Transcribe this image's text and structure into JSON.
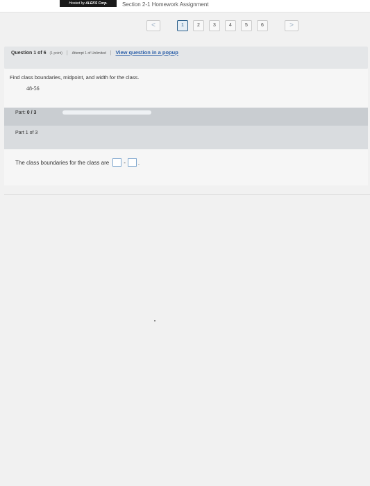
{
  "topbar": {
    "host_prefix": "Hosted by",
    "host_name": "ALEKS Corp.",
    "assignment_title": "Section 2-1 Homework Assignment"
  },
  "pager": {
    "prev_label": "<",
    "next_label": ">",
    "pages": [
      "1",
      "2",
      "3",
      "4",
      "5",
      "6"
    ],
    "active_page": "1"
  },
  "question": {
    "number_label": "Question 1 of 6",
    "points": "(1 point)",
    "attempt": "Attempt 1 of Unlimited",
    "popup_link": "View question in a popup"
  },
  "content": {
    "prompt": "Find class boundaries, midpoint, and width for the class.",
    "interval": "48-56"
  },
  "part_progress": {
    "label": "Part:",
    "score": "0 / 3",
    "fraction_complete": 0
  },
  "part_section": {
    "label": "Part 1 of 3"
  },
  "answer": {
    "text": "The class boundaries for the class are",
    "separator": "-",
    "end": "."
  },
  "colors": {
    "link": "#2a5ea8",
    "input_border": "#7fa7cf",
    "active_page_border": "#2c5f8a"
  }
}
